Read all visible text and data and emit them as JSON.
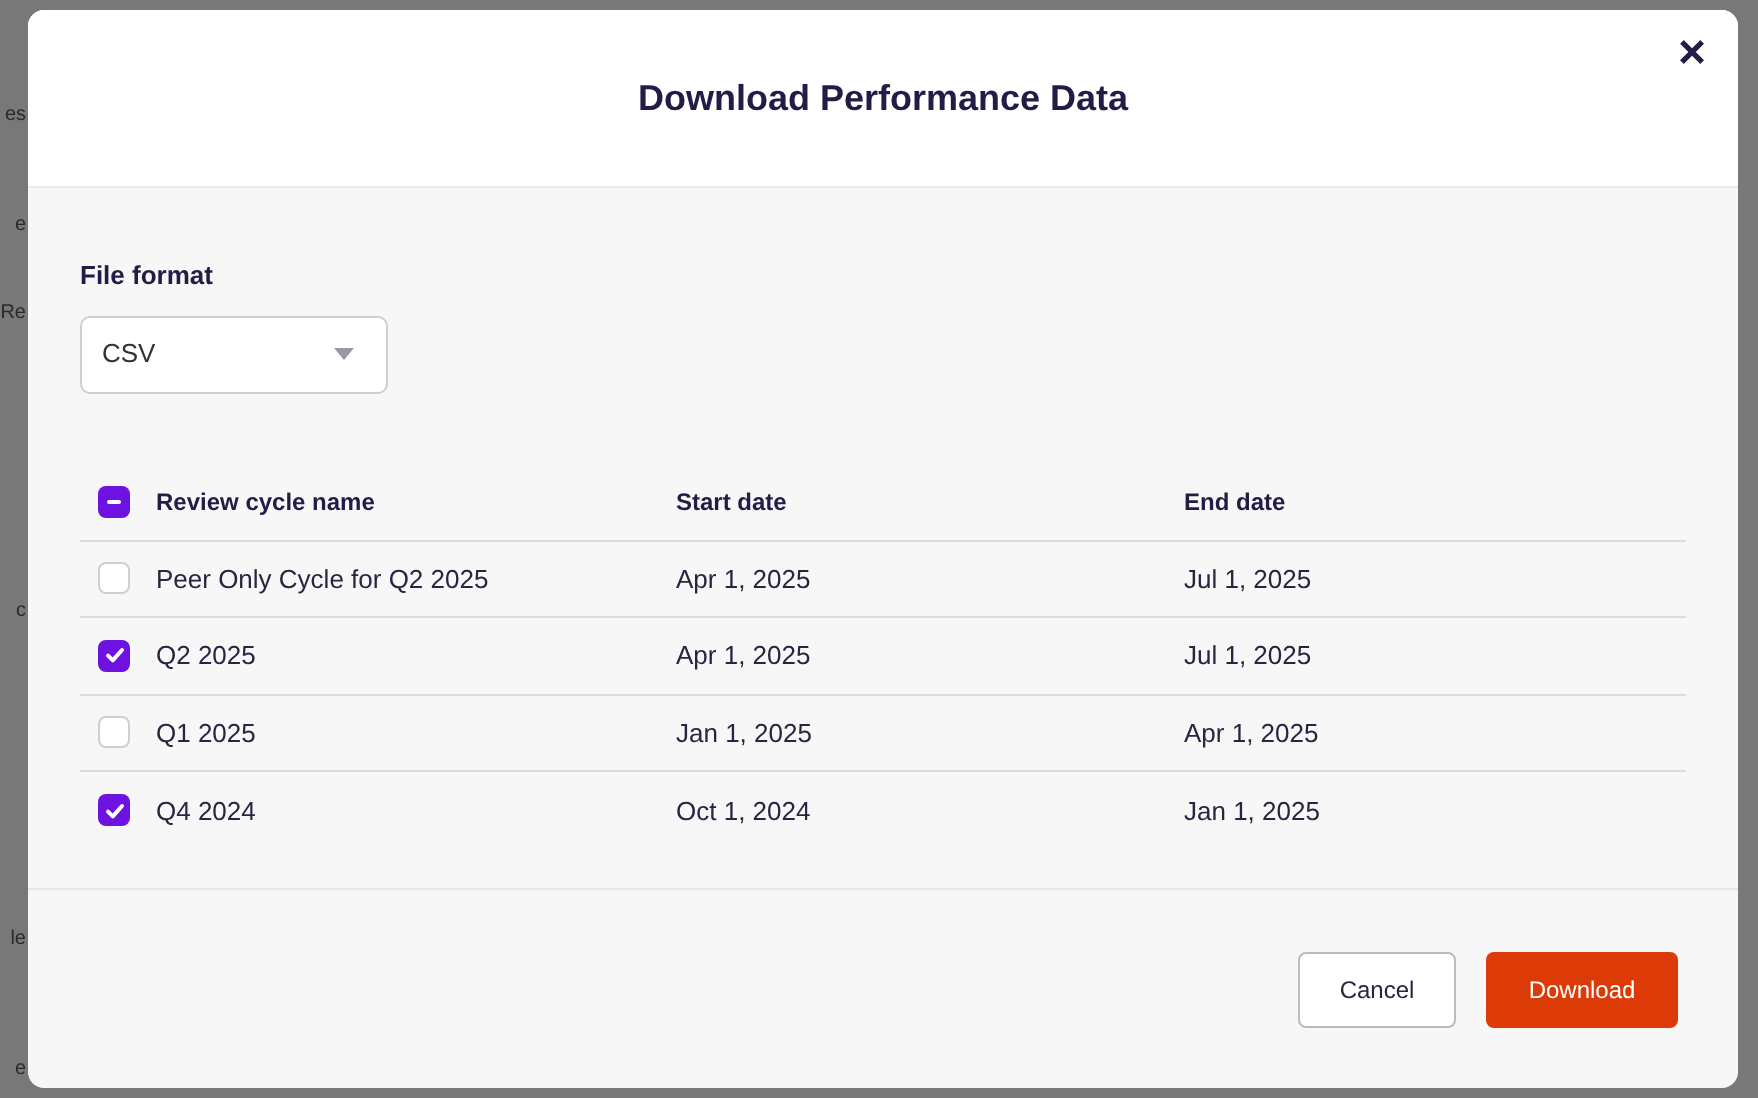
{
  "background": {
    "fragments": [
      "es",
      "e",
      "Re",
      "c",
      "le",
      "e"
    ]
  },
  "dialog": {
    "title": "Download Performance Data",
    "close": "×",
    "file_format": {
      "label": "File format",
      "value": "CSV"
    },
    "table": {
      "select_all": {
        "indeterminate": true
      },
      "columns": [
        "Review cycle name",
        "Start date",
        "End date"
      ],
      "rows": [
        {
          "checked": false,
          "cells": [
            "Peer Only Cycle for Q2 2025",
            "Apr 1, 2025",
            "Jul 1, 2025"
          ]
        },
        {
          "checked": true,
          "cells": [
            "Q2 2025",
            "Apr 1, 2025",
            "Jul 1, 2025"
          ]
        },
        {
          "checked": false,
          "cells": [
            "Q1 2025",
            "Jan 1, 2025",
            "Apr 1, 2025"
          ]
        },
        {
          "checked": true,
          "cells": [
            "Q4 2024",
            "Oct 1, 2024",
            "Jan 1, 2025"
          ]
        }
      ]
    },
    "buttons": [
      {
        "label": "Cancel",
        "kind": "secondary"
      },
      {
        "label": "Download",
        "kind": "primary"
      }
    ]
  }
}
